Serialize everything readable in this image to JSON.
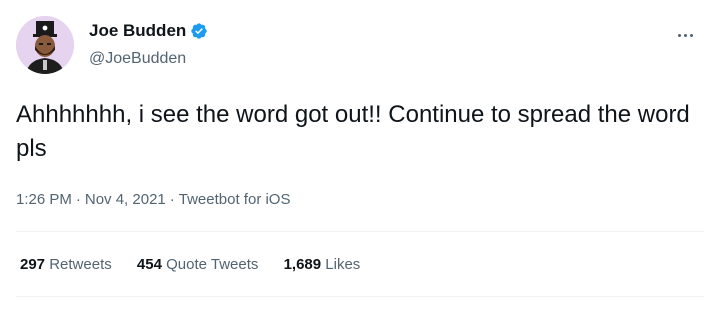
{
  "tweet": {
    "author": {
      "display_name": "Joe Budden",
      "handle": "@JoeBudden",
      "verified_icon": "verified-badge-icon",
      "badge_color": "#1d9bf0"
    },
    "text": "Ahhhhhhh, i see the word got out!! Continue to spread the word pls",
    "meta": {
      "time": "1:26 PM",
      "separator": "·",
      "date": "Nov 4, 2021",
      "source": "Tweetbot for iOS"
    },
    "stats": [
      {
        "count": "297",
        "label": "Retweets"
      },
      {
        "count": "454",
        "label": "Quote Tweets"
      },
      {
        "count": "1,689",
        "label": "Likes"
      }
    ],
    "more_icon": "more-options-icon"
  }
}
